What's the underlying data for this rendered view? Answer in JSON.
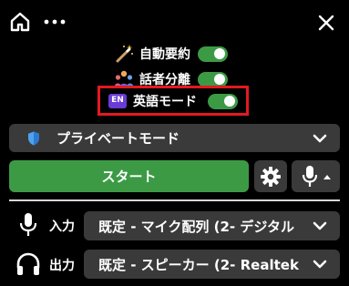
{
  "header": {
    "home_icon": "home-icon",
    "more_icon": "more-horizontal-icon",
    "close_icon": "close-icon"
  },
  "toggles": [
    {
      "label": "自動要約",
      "icon": "magic-wand-icon",
      "on": true
    },
    {
      "label": "話者分離",
      "icon": "people-group-icon",
      "on": true
    },
    {
      "label": "英語モード",
      "icon": "en-badge-icon",
      "badge": "EN",
      "on": true
    }
  ],
  "mode_select": {
    "value": "プライベートモード",
    "icon": "shield-icon"
  },
  "actions": {
    "start_label": "スタート",
    "settings_icon": "gear-icon",
    "mic_icon": "microphone-icon"
  },
  "input": {
    "label": "入力",
    "value": "既定 - マイク配列 (2- デジタル"
  },
  "output": {
    "label": "出力",
    "value": "既定 - スピーカー (2- Realtek"
  },
  "colors": {
    "accent_green": "#3c9a45",
    "highlight_red": "#e31920",
    "panel_gray": "#3a3a3a",
    "badge_purple": "#6a3cd6"
  }
}
